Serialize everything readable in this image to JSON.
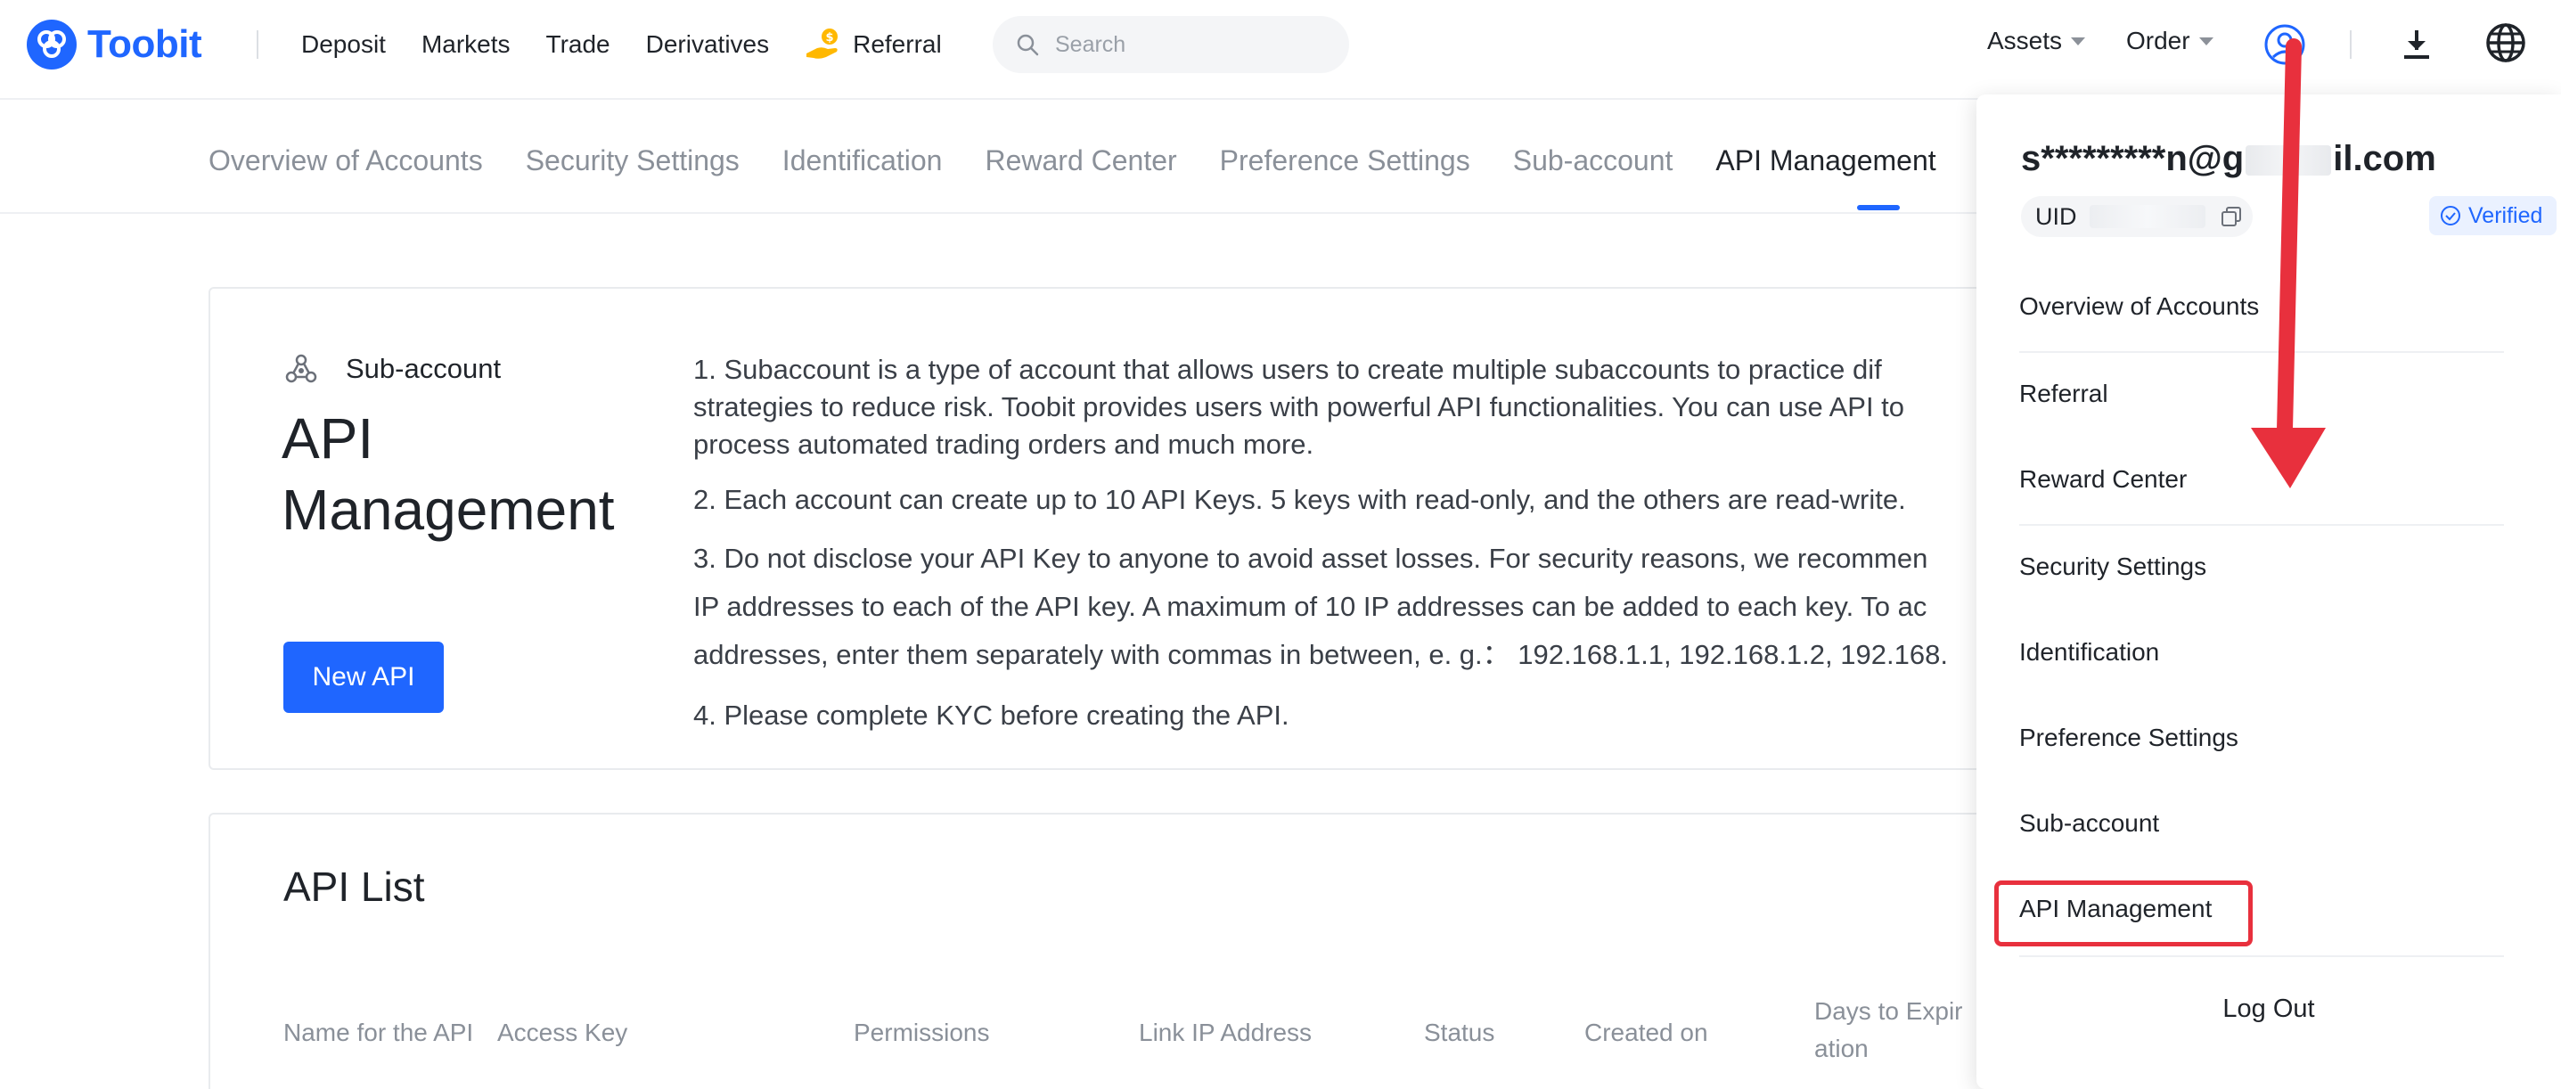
{
  "brand": {
    "name": "Toobit",
    "color": "#1f66ff"
  },
  "nav": {
    "links": [
      "Deposit",
      "Markets",
      "Trade",
      "Derivatives"
    ],
    "referral": "Referral",
    "search_placeholder": "Search",
    "assets": "Assets",
    "order": "Order"
  },
  "tabs": [
    {
      "label": "Overview of Accounts",
      "active": false
    },
    {
      "label": "Security Settings",
      "active": false
    },
    {
      "label": "Identification",
      "active": false
    },
    {
      "label": "Reward Center",
      "active": false
    },
    {
      "label": "Preference Settings",
      "active": false
    },
    {
      "label": "Sub-account",
      "active": false
    },
    {
      "label": "API Management",
      "active": true
    }
  ],
  "card": {
    "sub_label": "Sub-account",
    "title": "API Management",
    "new_api_button": "New API",
    "notes": [
      "1. Subaccount is a type of account that allows users to create multiple subaccounts to practice dif",
      "strategies to reduce risk. Toobit provides users with powerful API functionalities. You can use API to",
      "process automated trading orders and much more.",
      "2. Each account can create up to 10 API Keys. 5 keys with read-only, and the others are read-write.",
      "3. Do not disclose your API Key to anyone to avoid asset losses. For security reasons, we recommen",
      "IP addresses to each of the API key. A maximum of 10 IP addresses can be added to each key. To ac",
      "addresses, enter them separately with commas in between, e. g.： 192.168.1.1, 192.168.1.2, 192.168.",
      "4. Please complete KYC before creating the API."
    ]
  },
  "api_list": {
    "title": "API List",
    "columns": [
      "Name for the API",
      "Access Key",
      "Permissions",
      "Link IP Address",
      "Status",
      "Created on",
      "Days to Expir",
      "ation"
    ]
  },
  "dropdown": {
    "email_prefix": "s*********n@g",
    "email_suffix": "il.com",
    "uid_label": "UID",
    "verified": "Verified",
    "items": [
      "Overview of Accounts",
      "Referral",
      "Reward Center",
      "Security Settings",
      "Identification",
      "Preference Settings",
      "Sub-account",
      "API Management"
    ],
    "highlighted_item": "API Management",
    "logout": "Log Out"
  },
  "annotation": {
    "highlight_color": "#e8303d"
  }
}
